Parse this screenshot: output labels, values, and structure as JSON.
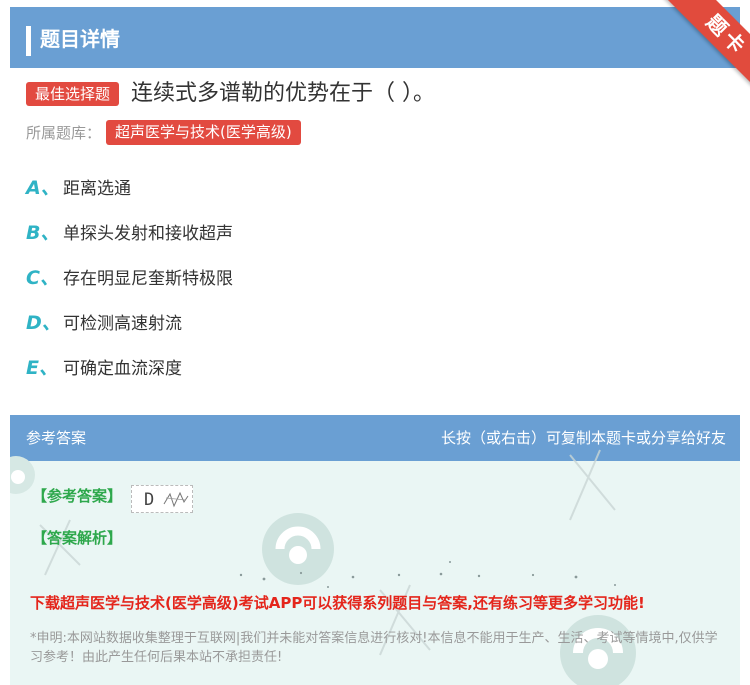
{
  "header": {
    "title": "题目详情"
  },
  "ribbon": {
    "label": "题卡"
  },
  "question": {
    "type_badge": "最佳选择题",
    "text": "连续式多谱勒的优势在于（ ）。",
    "library_label": "所属题库：",
    "library_name": "超声医学与技术(医学高级)"
  },
  "options": [
    {
      "letter": "A、",
      "text": "距离选通"
    },
    {
      "letter": "B、",
      "text": "单探头发射和接收超声"
    },
    {
      "letter": "C、",
      "text": "存在明显尼奎斯特极限"
    },
    {
      "letter": "D、",
      "text": "可检测高速射流"
    },
    {
      "letter": "E、",
      "text": "可确定血流深度"
    }
  ],
  "answer": {
    "bar_left": "参考答案",
    "bar_right": "长按（或右击）可复制本题卡或分享给好友",
    "ref_label": "【参考答案】",
    "value": "D",
    "analysis_label": "【答案解析】",
    "promo": "下载超声医学与技术(医学高级)考试APP可以获得系列题目与答案,还有练习等更多学习功能!",
    "disclaimer": "*申明:本网站数据收集整理于互联网|我们并未能对答案信息进行核对!本信息不能用于生产、生活、考试等情境中,仅供学习参考！由此产生任何后果本站不承担责任!"
  },
  "colors": {
    "header_blue": "#6a9fd3",
    "badge_red": "#e24a40",
    "ribbon_red": "#e14b3d",
    "option_letter_teal": "#2fb3c5",
    "answer_green": "#2ea84c",
    "promo_red": "#e4251b",
    "answer_bg": "#eaf6f4"
  }
}
